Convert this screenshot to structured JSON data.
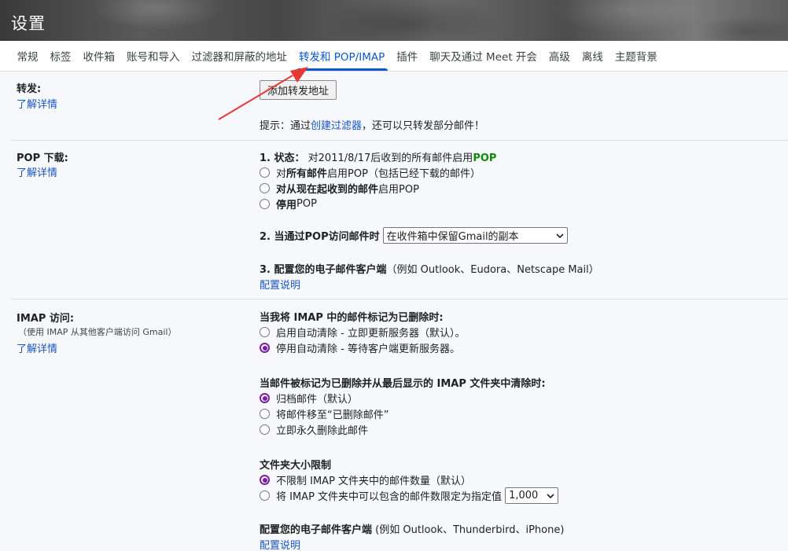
{
  "window": {
    "title": "设置"
  },
  "tabs": [
    {
      "label": "常规",
      "active": false
    },
    {
      "label": "标签",
      "active": false
    },
    {
      "label": "收件箱",
      "active": false
    },
    {
      "label": "账号和导入",
      "active": false
    },
    {
      "label": "过滤器和屏蔽的地址",
      "active": false
    },
    {
      "label": "转发和 POP/IMAP",
      "active": true
    },
    {
      "label": "插件",
      "active": false
    },
    {
      "label": "聊天及通过 Meet 开会",
      "active": false
    },
    {
      "label": "高级",
      "active": false
    },
    {
      "label": "离线",
      "active": false
    },
    {
      "label": "主题背景",
      "active": false
    }
  ],
  "forwarding": {
    "label": "转发:",
    "learn_more": "了解详情",
    "add_button": "添加转发地址",
    "tip_prefix": "提示：通过",
    "tip_link": "创建过滤器",
    "tip_suffix": "，还可以只转发部分邮件！"
  },
  "pop": {
    "label": "POP 下载:",
    "learn_more": "了解详情",
    "status_label": "1. 状态：",
    "status_text": " 对2011/8/17后收到的所有邮件启用",
    "status_value": "POP",
    "options": [
      {
        "pre": "对",
        "bold": "所有邮件",
        "post": "启用POP（包括已经下载的邮件）",
        "checked": false
      },
      {
        "pre": "",
        "bold": "对从现在起收到的邮件",
        "post": "启用POP",
        "checked": false
      },
      {
        "pre": "",
        "bold": "停用",
        "post": "POP",
        "checked": false
      }
    ],
    "access_label": "2. 当通过POP访问邮件时",
    "access_select": "在收件箱中保留Gmail的副本",
    "client_label": "3. 配置您的电子邮件客户端",
    "client_text": "（例如 Outlook、Eudora、Netscape Mail）",
    "config_link": "配置说明"
  },
  "imap": {
    "label": "IMAP 访问:",
    "sublabel": "（使用 IMAP 从其他客户端访问 Gmail）",
    "learn_more": "了解详情",
    "group1_title": "当我将 IMAP 中的邮件标记为已删除时:",
    "group1": [
      {
        "text": "启用自动清除 - 立即更新服务器（默认）。",
        "checked": false
      },
      {
        "text": "停用自动清除 - 等待客户端更新服务器。",
        "checked": true
      }
    ],
    "group2_title": "当邮件被标记为已删除并从最后显示的 IMAP 文件夹中清除时:",
    "group2": [
      {
        "text": "归档邮件（默认）",
        "checked": true
      },
      {
        "text": "将邮件移至“已删除邮件”",
        "checked": false
      },
      {
        "text": "立即永久删除此邮件",
        "checked": false
      }
    ],
    "group3_title": "文件夹大小限制",
    "group3": [
      {
        "text": "不限制 IMAP 文件夹中的邮件数量（默认）",
        "checked": true
      },
      {
        "text": "将 IMAP 文件夹中可以包含的邮件数限定为指定值",
        "checked": false
      }
    ],
    "limit_select": "1,000",
    "client_label": "配置您的电子邮件客户端",
    "client_text": " (例如 Outlook、Thunderbird、iPhone)",
    "config_link": "配置说明"
  },
  "colors": {
    "accent": "#0b57d0",
    "link": "#1a55c2",
    "radio": "#7b1fa2",
    "arrow": "#e53935",
    "pop_green": "#0a8a0a"
  }
}
